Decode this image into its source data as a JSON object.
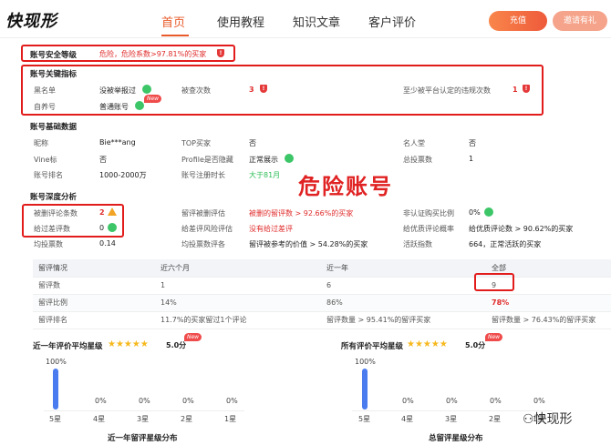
{
  "header": {
    "logo": "快现形",
    "nav": [
      "首页",
      "使用教程",
      "知识文章",
      "客户评价"
    ],
    "btn_charge": "充值",
    "btn_invite": "邀请有礼"
  },
  "security": {
    "label": "账号安全等级",
    "value": "危险，危险系数>97.81%的买家"
  },
  "key_indicators": {
    "title": "账号关键指标",
    "blacklist_label": "黑名单",
    "blacklist_value": "没被举报过",
    "reported_label": "被查次数",
    "reported_value": "3",
    "violation_label": "至少被平台认定的违规次数",
    "violation_value": "1",
    "self_label": "自养号",
    "self_value": "普通账号",
    "new_tag": "New"
  },
  "basic": {
    "title": "账号基础数据",
    "nick_label": "昵称",
    "nick_value": "Bie***ang",
    "top_label": "TOP买家",
    "top_value": "否",
    "celeb_label": "名人堂",
    "celeb_value": "否",
    "vine_label": "Vine标",
    "vine_value": "否",
    "profile_label": "Profile是否隐藏",
    "profile_value": "正常展示",
    "votes_label": "总投票数",
    "votes_value": "1",
    "rank_label": "账号排名",
    "rank_value": "1000-2000万",
    "reg_label": "账号注册时长",
    "reg_value": "大于81月"
  },
  "danger_banner": "危险账号",
  "deep": {
    "title": "账号深度分析",
    "deleted_label": "被删评论条数",
    "deleted_value": "2",
    "deleted_rate_label": "留评被删评估",
    "deleted_rate_value": "被删的留评数 > 92.66%的买家",
    "unverified_label": "非认证购买比例",
    "unverified_value": "0%",
    "bad_label": "给过差评数",
    "bad_value": "0",
    "bad_risk_label": "给差评风险评估",
    "bad_risk_value": "没有给过差评",
    "good_rate_label": "给优质评论概率",
    "good_rate_value": "给优质评论数 > 90.62%的买家",
    "avg_votes_label": "均投票数",
    "avg_votes_value": "0.14",
    "avg_votes_eval_label": "均投票数评各",
    "avg_votes_eval_value": "留评被参考的价值 > 54.28%的买家",
    "active_label": "活跃指数",
    "active_value": "664，正常活跃的买家"
  },
  "table": {
    "headers": [
      "留评情况",
      "近六个月",
      "近一年",
      "全部"
    ],
    "rows": [
      [
        "留评数",
        "1",
        "6",
        "9"
      ],
      [
        "留评比例",
        "14%",
        "86%",
        "78%"
      ],
      [
        "留评排名",
        "11.7%的买家留过1个评论",
        "留评数量 > 95.41%的留评买家",
        "留评数量 > 76.43%的留评买家"
      ]
    ]
  },
  "rating_year": {
    "title": "近一年评价平均星级",
    "score": "5.0分",
    "new_tag": "New",
    "top_pct": "100%",
    "labels": [
      "5星",
      "4星",
      "3星",
      "2星",
      "1星"
    ],
    "pcts": [
      "",
      "0%",
      "0%",
      "0%",
      "0%"
    ],
    "footer": "近一年留评星级分布"
  },
  "rating_all": {
    "title": "所有评价平均星级",
    "score": "5.0分",
    "new_tag": "New",
    "top_pct": "100%",
    "labels": [
      "5星",
      "4星",
      "3星",
      "2星",
      "1星"
    ],
    "pcts": [
      "",
      "0%",
      "0%",
      "0%",
      "0%"
    ],
    "footer": "总留评星级分布"
  },
  "watermark": "快现形",
  "colors": {
    "accent": "#e85a2a",
    "danger": "#e02b2b",
    "ok": "#2fbf58",
    "bar": "#4a7cf0"
  }
}
